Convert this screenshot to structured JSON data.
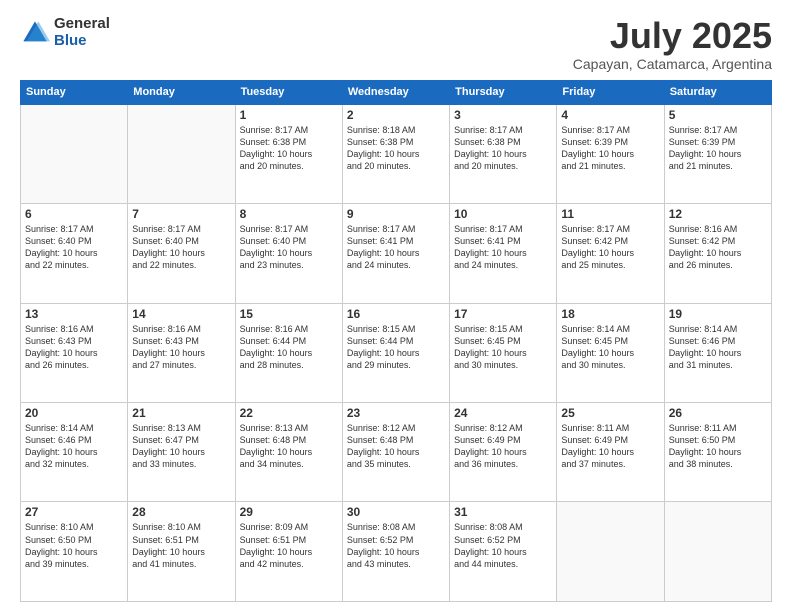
{
  "header": {
    "logo_general": "General",
    "logo_blue": "Blue",
    "month_title": "July 2025",
    "subtitle": "Capayan, Catamarca, Argentina"
  },
  "weekdays": [
    "Sunday",
    "Monday",
    "Tuesday",
    "Wednesday",
    "Thursday",
    "Friday",
    "Saturday"
  ],
  "weeks": [
    [
      {
        "day": "",
        "info": ""
      },
      {
        "day": "",
        "info": ""
      },
      {
        "day": "1",
        "info": "Sunrise: 8:17 AM\nSunset: 6:38 PM\nDaylight: 10 hours\nand 20 minutes."
      },
      {
        "day": "2",
        "info": "Sunrise: 8:18 AM\nSunset: 6:38 PM\nDaylight: 10 hours\nand 20 minutes."
      },
      {
        "day": "3",
        "info": "Sunrise: 8:17 AM\nSunset: 6:38 PM\nDaylight: 10 hours\nand 20 minutes."
      },
      {
        "day": "4",
        "info": "Sunrise: 8:17 AM\nSunset: 6:39 PM\nDaylight: 10 hours\nand 21 minutes."
      },
      {
        "day": "5",
        "info": "Sunrise: 8:17 AM\nSunset: 6:39 PM\nDaylight: 10 hours\nand 21 minutes."
      }
    ],
    [
      {
        "day": "6",
        "info": "Sunrise: 8:17 AM\nSunset: 6:40 PM\nDaylight: 10 hours\nand 22 minutes."
      },
      {
        "day": "7",
        "info": "Sunrise: 8:17 AM\nSunset: 6:40 PM\nDaylight: 10 hours\nand 22 minutes."
      },
      {
        "day": "8",
        "info": "Sunrise: 8:17 AM\nSunset: 6:40 PM\nDaylight: 10 hours\nand 23 minutes."
      },
      {
        "day": "9",
        "info": "Sunrise: 8:17 AM\nSunset: 6:41 PM\nDaylight: 10 hours\nand 24 minutes."
      },
      {
        "day": "10",
        "info": "Sunrise: 8:17 AM\nSunset: 6:41 PM\nDaylight: 10 hours\nand 24 minutes."
      },
      {
        "day": "11",
        "info": "Sunrise: 8:17 AM\nSunset: 6:42 PM\nDaylight: 10 hours\nand 25 minutes."
      },
      {
        "day": "12",
        "info": "Sunrise: 8:16 AM\nSunset: 6:42 PM\nDaylight: 10 hours\nand 26 minutes."
      }
    ],
    [
      {
        "day": "13",
        "info": "Sunrise: 8:16 AM\nSunset: 6:43 PM\nDaylight: 10 hours\nand 26 minutes."
      },
      {
        "day": "14",
        "info": "Sunrise: 8:16 AM\nSunset: 6:43 PM\nDaylight: 10 hours\nand 27 minutes."
      },
      {
        "day": "15",
        "info": "Sunrise: 8:16 AM\nSunset: 6:44 PM\nDaylight: 10 hours\nand 28 minutes."
      },
      {
        "day": "16",
        "info": "Sunrise: 8:15 AM\nSunset: 6:44 PM\nDaylight: 10 hours\nand 29 minutes."
      },
      {
        "day": "17",
        "info": "Sunrise: 8:15 AM\nSunset: 6:45 PM\nDaylight: 10 hours\nand 30 minutes."
      },
      {
        "day": "18",
        "info": "Sunrise: 8:14 AM\nSunset: 6:45 PM\nDaylight: 10 hours\nand 30 minutes."
      },
      {
        "day": "19",
        "info": "Sunrise: 8:14 AM\nSunset: 6:46 PM\nDaylight: 10 hours\nand 31 minutes."
      }
    ],
    [
      {
        "day": "20",
        "info": "Sunrise: 8:14 AM\nSunset: 6:46 PM\nDaylight: 10 hours\nand 32 minutes."
      },
      {
        "day": "21",
        "info": "Sunrise: 8:13 AM\nSunset: 6:47 PM\nDaylight: 10 hours\nand 33 minutes."
      },
      {
        "day": "22",
        "info": "Sunrise: 8:13 AM\nSunset: 6:48 PM\nDaylight: 10 hours\nand 34 minutes."
      },
      {
        "day": "23",
        "info": "Sunrise: 8:12 AM\nSunset: 6:48 PM\nDaylight: 10 hours\nand 35 minutes."
      },
      {
        "day": "24",
        "info": "Sunrise: 8:12 AM\nSunset: 6:49 PM\nDaylight: 10 hours\nand 36 minutes."
      },
      {
        "day": "25",
        "info": "Sunrise: 8:11 AM\nSunset: 6:49 PM\nDaylight: 10 hours\nand 37 minutes."
      },
      {
        "day": "26",
        "info": "Sunrise: 8:11 AM\nSunset: 6:50 PM\nDaylight: 10 hours\nand 38 minutes."
      }
    ],
    [
      {
        "day": "27",
        "info": "Sunrise: 8:10 AM\nSunset: 6:50 PM\nDaylight: 10 hours\nand 39 minutes."
      },
      {
        "day": "28",
        "info": "Sunrise: 8:10 AM\nSunset: 6:51 PM\nDaylight: 10 hours\nand 41 minutes."
      },
      {
        "day": "29",
        "info": "Sunrise: 8:09 AM\nSunset: 6:51 PM\nDaylight: 10 hours\nand 42 minutes."
      },
      {
        "day": "30",
        "info": "Sunrise: 8:08 AM\nSunset: 6:52 PM\nDaylight: 10 hours\nand 43 minutes."
      },
      {
        "day": "31",
        "info": "Sunrise: 8:08 AM\nSunset: 6:52 PM\nDaylight: 10 hours\nand 44 minutes."
      },
      {
        "day": "",
        "info": ""
      },
      {
        "day": "",
        "info": ""
      }
    ]
  ]
}
